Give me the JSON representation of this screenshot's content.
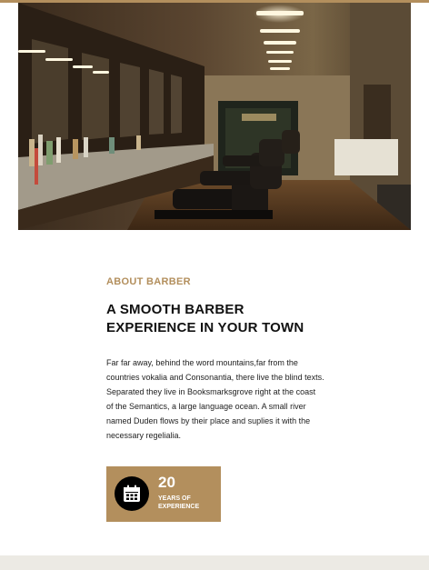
{
  "about": {
    "eyebrow": "ABOUT BARBER",
    "heading_line1": "A SMOOTH BARBER",
    "heading_line2": "EXPERIENCE IN YOUR TOWN",
    "paragraph": "Far far away, behind the word mountains,far from the countries vokalia and Consonantia, there live the blind texts. Separated they live in Booksmarksgrove right at the coast of the Semantics, a large language ocean. A small river named Duden flows by their place and suplies it with the necessary regelialia."
  },
  "stat": {
    "number": "20",
    "label": "YEARS OF EXPERIENCE",
    "icon": "calendar-icon"
  },
  "hero_image": {
    "subject": "barbershop-interior-photo"
  },
  "colors": {
    "accent": "#b38f5d",
    "heading": "#111111",
    "footer": "#eceae4"
  }
}
